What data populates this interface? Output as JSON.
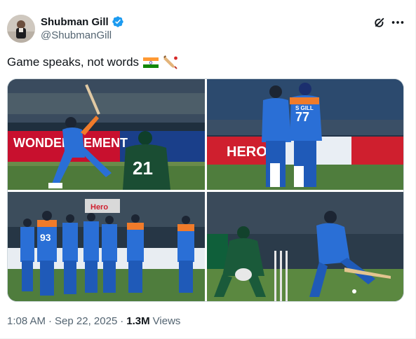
{
  "author": {
    "name": "Shubman Gill",
    "handle": "@ShubmanGill"
  },
  "post": {
    "text": "Game speaks, not words",
    "emojis": [
      "india-flag-icon",
      "cricket-bat-icon"
    ]
  },
  "media": {
    "photos": [
      {
        "banner_text": "WONDER CEMENT",
        "jersey_text": "21"
      },
      {
        "jersey_text": "77",
        "shirt_text": "S GILL",
        "banner_text": "HERO"
      },
      {
        "jersey_text": "93",
        "banner_text": "Hero"
      },
      {
        "banner_text": ""
      }
    ]
  },
  "meta": {
    "time": "1:08 AM",
    "separator": "·",
    "date": "Sep 22, 2025",
    "separator2": "·",
    "views_count": "1.3M",
    "views_label": "Views"
  },
  "colors": {
    "verified": "#1d9bf0",
    "text_primary": "#0f1419",
    "text_secondary": "#536471"
  }
}
